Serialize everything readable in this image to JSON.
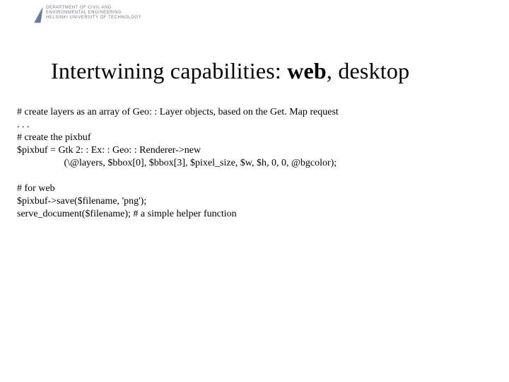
{
  "header": {
    "org_line1": "DEPARTMENT OF CIVIL AND",
    "org_line2": "ENVIRONMENTAL ENGINEERING",
    "org_line3": "HELSINKI UNIVERSITY OF TECHNOLOGY"
  },
  "title": {
    "part1": "Intertwining capabilities: ",
    "bold": "web",
    "part2": ", desktop"
  },
  "code": {
    "line1": "# create layers as an array of Geo: : Layer objects, based on the Get. Map request",
    "line2": ". . .",
    "line3": "# create the pixbuf",
    "line4": "$pixbuf = Gtk 2: : Ex: : Geo: : Renderer->new",
    "line5": "                   (\\@layers, $bbox[0], $bbox[3], $pixel_size, $w, $h, 0, 0, @bgcolor);",
    "line6": "",
    "line7": "# for web",
    "line8": "$pixbuf->save($filename, 'png');",
    "line9": "serve_document($filename); # a simple helper function"
  }
}
